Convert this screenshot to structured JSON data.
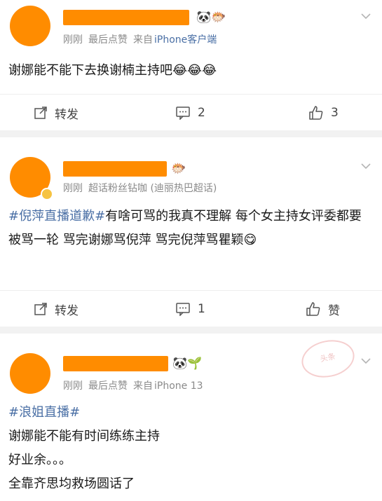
{
  "posts": [
    {
      "meta": {
        "time": "刚刚",
        "extra": "最后点赞",
        "source_prefix": "来自",
        "source": "iPhone客户端"
      },
      "content_text": "谢娜能不能下去换谢楠主持吧",
      "emojis": [
        "😂",
        "😂",
        "😂"
      ],
      "name_icons": "🐼🐡",
      "actions": {
        "repost_label": "转发",
        "comment_count": "2",
        "like_count": "3"
      }
    },
    {
      "meta": {
        "time": "刚刚",
        "extra": "超话粉丝钻咖 (迪丽热巴超话)"
      },
      "topic": "#倪萍直播道歉#",
      "content_text": "有啥可骂的我真不理解 每个女主持女评委都要被骂一轮 骂完谢娜骂倪萍 骂完倪萍骂瞿颖",
      "emojis": [
        "😋"
      ],
      "name_icons": "🐡",
      "actions": {
        "repost_label": "转发",
        "comment_count": "1",
        "like_label": "赞"
      }
    },
    {
      "meta": {
        "time": "刚刚",
        "extra": "最后点赞",
        "source_prefix": "来自",
        "source": "iPhone 13"
      },
      "topic": "#浪姐直播#",
      "lines": [
        "谢娜能不能有时间练练主持",
        "好业余。。。",
        "全靠齐思均救场圆话了"
      ],
      "name_icons": "🐼🌱",
      "stamp_text": "头条"
    }
  ],
  "colors": {
    "accent": "#4a6fa5",
    "avatar": "#ff8c00",
    "separator": "#f2f2f2"
  }
}
